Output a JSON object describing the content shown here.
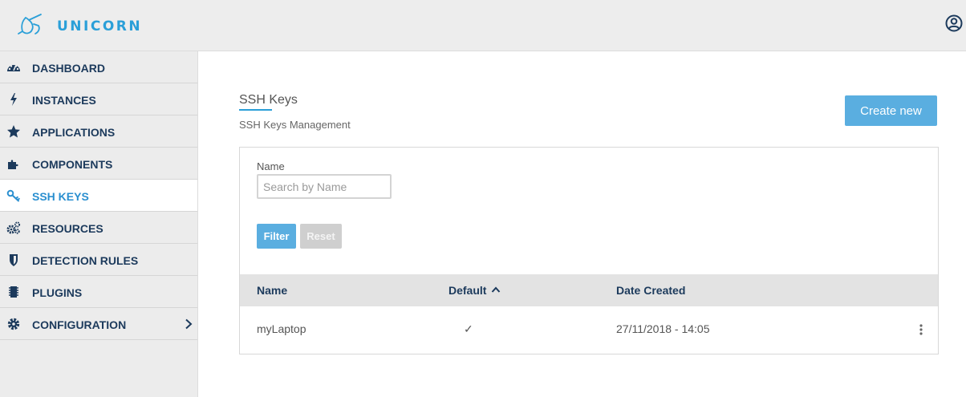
{
  "app": {
    "brand": "UNICORN"
  },
  "sidebar": {
    "items": [
      {
        "label": "DASHBOARD",
        "icon": "dashboard-icon"
      },
      {
        "label": "INSTANCES",
        "icon": "bolt-icon"
      },
      {
        "label": "APPLICATIONS",
        "icon": "star-icon"
      },
      {
        "label": "COMPONENTS",
        "icon": "puzzle-icon"
      },
      {
        "label": "SSH KEYS",
        "icon": "key-icon",
        "active": true
      },
      {
        "label": "RESOURCES",
        "icon": "cogs-icon"
      },
      {
        "label": "DETECTION RULES",
        "icon": "shield-icon"
      },
      {
        "label": "PLUGINS",
        "icon": "chip-icon"
      },
      {
        "label": "CONFIGURATION",
        "icon": "gear-icon"
      }
    ]
  },
  "page": {
    "title": "SSH Keys",
    "subtitle": "SSH Keys Management",
    "create_label": "Create new"
  },
  "filter": {
    "name_label": "Name",
    "placeholder": "Search by Name",
    "value": "",
    "filter_label": "Filter",
    "reset_label": "Reset"
  },
  "table": {
    "columns": [
      "Name",
      "Default",
      "Date Created"
    ],
    "sorted_by": "Default",
    "rows": [
      {
        "name": "myLaptop",
        "default": "✓",
        "date_created": "27/11/2018 - 14:05"
      }
    ]
  },
  "colors": {
    "accent": "#2a9fd8",
    "button": "#5aaee0",
    "nav_text": "#1c3a5c",
    "sidebar_bg": "#ececec"
  }
}
